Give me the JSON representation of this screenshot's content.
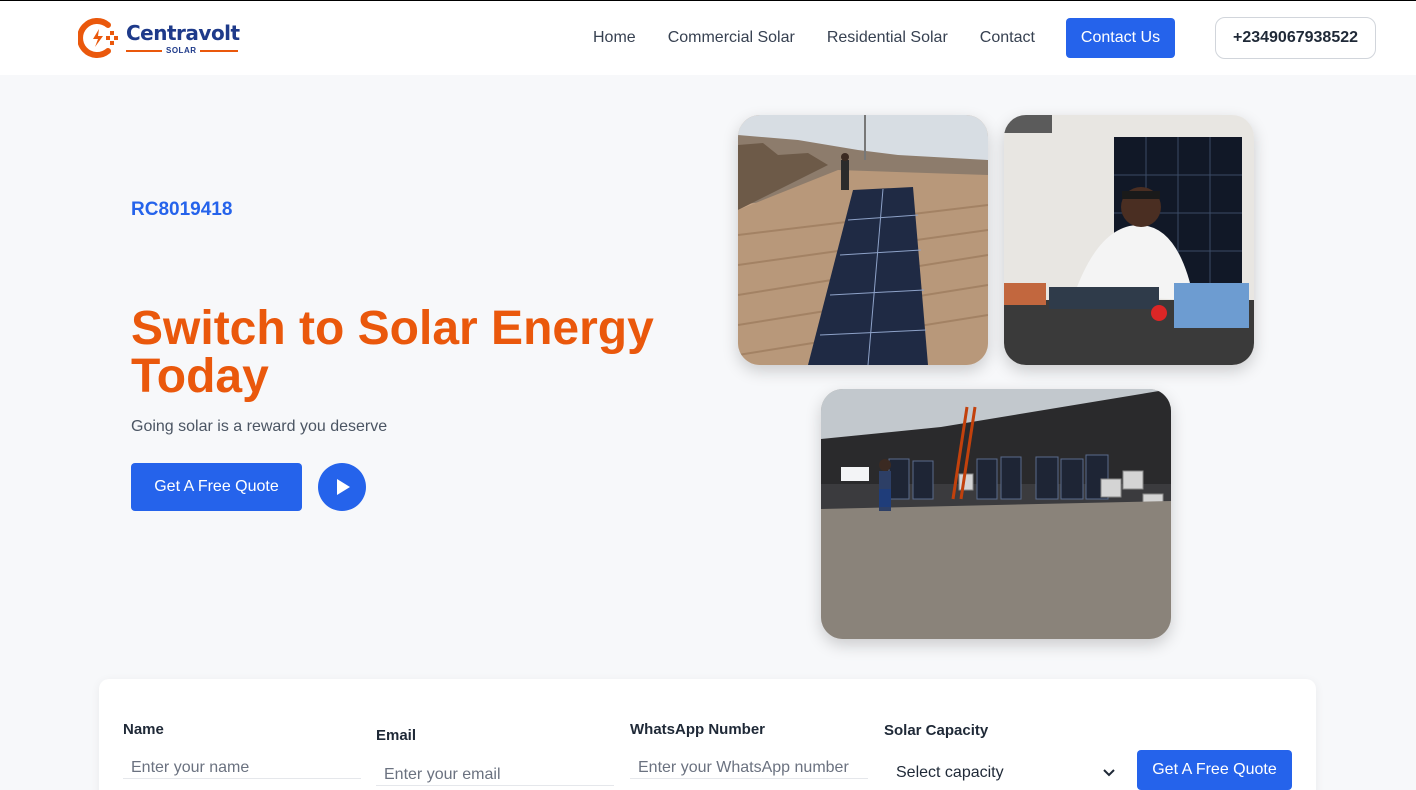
{
  "brand": {
    "name": "Centravolt",
    "sub": "SOLAR",
    "colors": {
      "primary": "#2563eb",
      "accent": "#ea580c",
      "navy": "#1e3a8a"
    }
  },
  "nav": {
    "items": [
      "Home",
      "Commercial Solar",
      "Residential Solar",
      "Contact"
    ],
    "contact_button": "Contact Us",
    "phone": "+2349067938522"
  },
  "hero": {
    "rc_number": "RC8019418",
    "title": "Switch to Solar Energy Today",
    "subtitle": "Going solar is a reward you deserve",
    "quote_button": "Get A Free Quote",
    "play_icon": "play-icon"
  },
  "form": {
    "name_label": "Name",
    "name_placeholder": "Enter your name",
    "email_label": "Email",
    "email_placeholder": "Enter your email",
    "whatsapp_label": "WhatsApp Number",
    "whatsapp_placeholder": "Enter your WhatsApp number",
    "capacity_label": "Solar Capacity",
    "capacity_selected": "Select capacity",
    "submit_label": "Get A Free Quote"
  }
}
